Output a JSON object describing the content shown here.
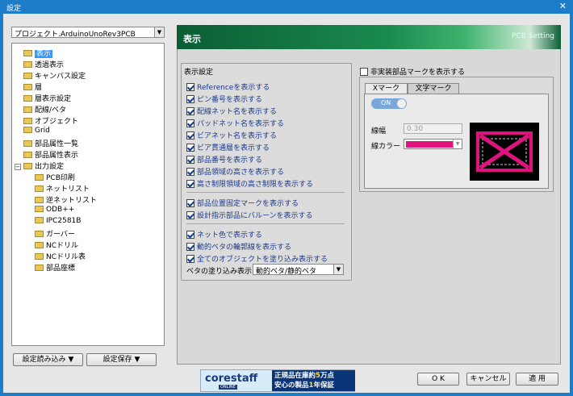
{
  "window": {
    "title": "設定",
    "close": "✕"
  },
  "project_select": {
    "value": "プロジェクト.ArduinoUnoRev3PCB"
  },
  "tree": {
    "items": [
      "表示",
      "透過表示",
      "キャンバス設定",
      "層",
      "層表示設定",
      "配線/ベタ",
      "オブジェクト",
      "Grid",
      "部品属性一覧",
      "部品属性表示"
    ],
    "group": {
      "label": "出力設定",
      "toggle": "−"
    },
    "children": [
      "PCB印刷",
      "ネットリスト",
      "逆ネットリスト",
      "ODB++",
      "IPC2581B",
      "ガーバー",
      "NCドリル",
      "NCドリル表",
      "部品座標"
    ]
  },
  "left_buttons": {
    "load": "設定読み込み ▼",
    "save": "設定保存 ▼"
  },
  "banner": {
    "title": "表示",
    "subtitle": "PCB Setting"
  },
  "display_group": {
    "title": "表示設定",
    "section1": [
      "Referenceを表示する",
      "ピン番号を表示する",
      "配線ネット名を表示する",
      "パッドネット名を表示する",
      "ビアネット名を表示する",
      "ビア貫通層を表示する",
      "部品番号を表示する",
      "部品領域の高さを表示する",
      "高さ制限領域の高さ制限を表示する"
    ],
    "section2": [
      "部品位置固定マークを表示する",
      "設計指示部品にバルーンを表示する"
    ],
    "section3": [
      "ネット色で表示する",
      "動的ベタの輪郭線を表示する",
      "全てのオブジェクトを塗り込み表示する"
    ],
    "fill_label": "ベタの塗り込み表示",
    "fill_value": "動的ベタ/静的ベタ",
    "dropdown_arrow": "▼"
  },
  "unmounted": {
    "label": "非実装部品マークを表示する",
    "tabs": [
      "Xマーク",
      "文字マーク"
    ],
    "toggle": "ON",
    "width_label": "線幅",
    "width_value": "0.30",
    "color_label": "線カラー",
    "color": "#e0137e"
  },
  "ad": {
    "logo": "corestaff",
    "sub": "ONLINE",
    "line1a": "正規品在庫約",
    "line1b": "5",
    "line1c": "万点",
    "line2a": "安心の製品",
    "line2b": "1",
    "line2c": "年保証"
  },
  "footer": {
    "ok": "O K",
    "cancel": "キャンセル",
    "apply": "適 用"
  }
}
